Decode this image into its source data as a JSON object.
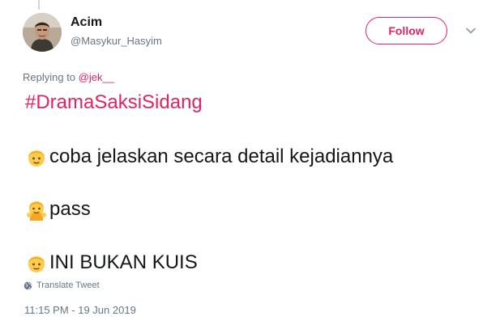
{
  "user": {
    "display_name": "Acim",
    "handle": "@Masykur_Hasyim"
  },
  "follow_button": {
    "label": "Follow"
  },
  "reply_context": {
    "prefix": "Replying to",
    "mention": "@jek__"
  },
  "tweet": {
    "hashtag": "#DramaSaksiSidang",
    "lines": [
      {
        "emoji": "person-blond-emoji",
        "text": "coba jelaskan secara detail kejadiannya"
      },
      {
        "emoji": "person-gesturing-ok-emoji",
        "text": "pass"
      },
      {
        "emoji": "person-blond-emoji",
        "text": "INI BUKAN KUIS"
      }
    ]
  },
  "translate": {
    "label": "Translate Tweet",
    "icon": "globe-icon"
  },
  "timestamp": "11:15 PM - 19 Jun 2019",
  "colors": {
    "accent": "#e0245e",
    "secondary_text": "#657786",
    "primary_text": "#14171a",
    "emoji_skin": "#ffcb4c",
    "emoji_hair": "#f6a623"
  }
}
